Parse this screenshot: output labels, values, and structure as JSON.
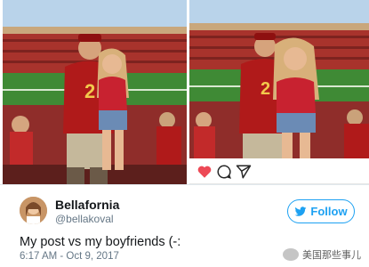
{
  "tweet": {
    "display_name": "Bellafornia",
    "handle": "@bellakoval",
    "follow_label": "Follow",
    "text": "My post vs my boyfriends (-:",
    "timestamp": "6:17 AM - Oct 9, 2017"
  },
  "instagram_bar": {
    "icons": [
      "heart-icon",
      "comment-icon",
      "send-icon"
    ]
  },
  "photos": {
    "left_jersey_number": "2",
    "right_jersey_number": "2"
  },
  "watermark": {
    "text": "美国那些事儿"
  },
  "colors": {
    "twitter_blue": "#1da1f2",
    "heart_red": "#ed4956",
    "jersey_red": "#b01a1a",
    "stadium_red": "#a8332c",
    "field_green": "#3f8a35"
  }
}
